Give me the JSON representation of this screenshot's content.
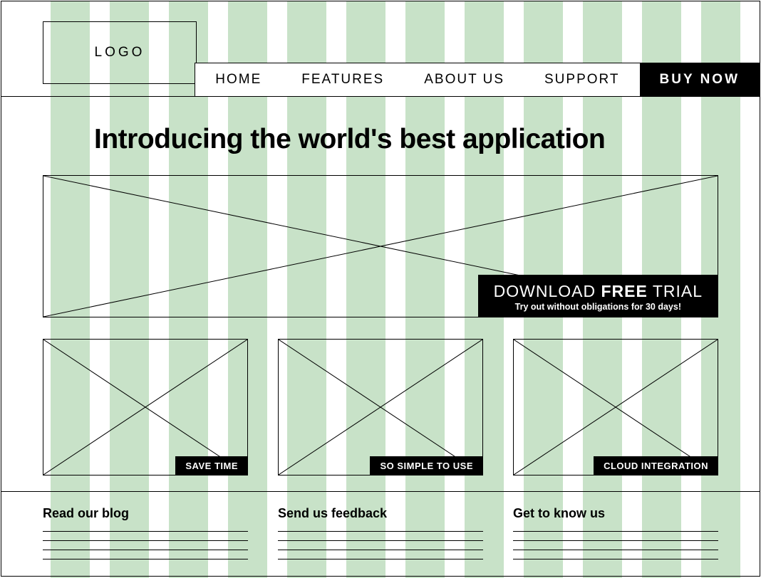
{
  "logo": "LOGO",
  "nav": {
    "home": "HOME",
    "features": "FEATURES",
    "about": "ABOUT US",
    "support": "SUPPORT",
    "buy": "BUY NOW"
  },
  "hero": {
    "headline": "Introducing the world's best application",
    "cta_prefix": "DOWNLOAD ",
    "cta_bold": "FREE",
    "cta_suffix": " TRIAL",
    "cta_sub": "Try out without obligations for 30 days!"
  },
  "features": [
    {
      "tag": "SAVE TIME"
    },
    {
      "tag": "SO SIMPLE TO USE"
    },
    {
      "tag": "CLOUD INTEGRATION"
    }
  ],
  "footer": [
    {
      "title": "Read our blog"
    },
    {
      "title": "Send us feedback"
    },
    {
      "title": "Get to know us"
    }
  ]
}
